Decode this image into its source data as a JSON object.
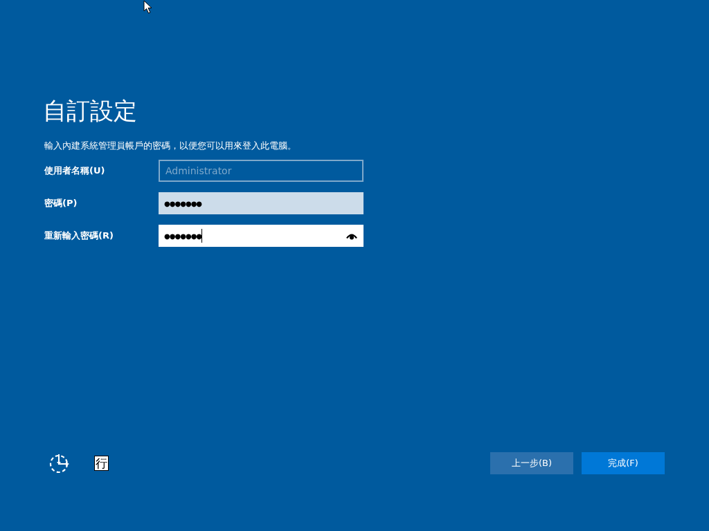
{
  "title": "自訂設定",
  "description": "輸入內建系統管理員帳戶的密碼，以便您可以用來登入此電腦。",
  "fields": [
    {
      "label": "使用者名稱(U)",
      "value": "Administrator",
      "disabled": true,
      "hovered": false,
      "focused": false,
      "reveal_button": false
    },
    {
      "label": "密碼(P)",
      "value": "●●●●●●●",
      "disabled": false,
      "hovered": true,
      "focused": false,
      "reveal_button": false
    },
    {
      "label": "重新輸入密碼(R)",
      "value": "●●●●●●●",
      "disabled": false,
      "hovered": false,
      "focused": true,
      "reveal_button": true
    }
  ],
  "ime_indicator": "行",
  "buttons": [
    {
      "label": "上一步(B)",
      "kind": "secondary"
    },
    {
      "label": "完成(F)",
      "kind": "primary"
    }
  ]
}
